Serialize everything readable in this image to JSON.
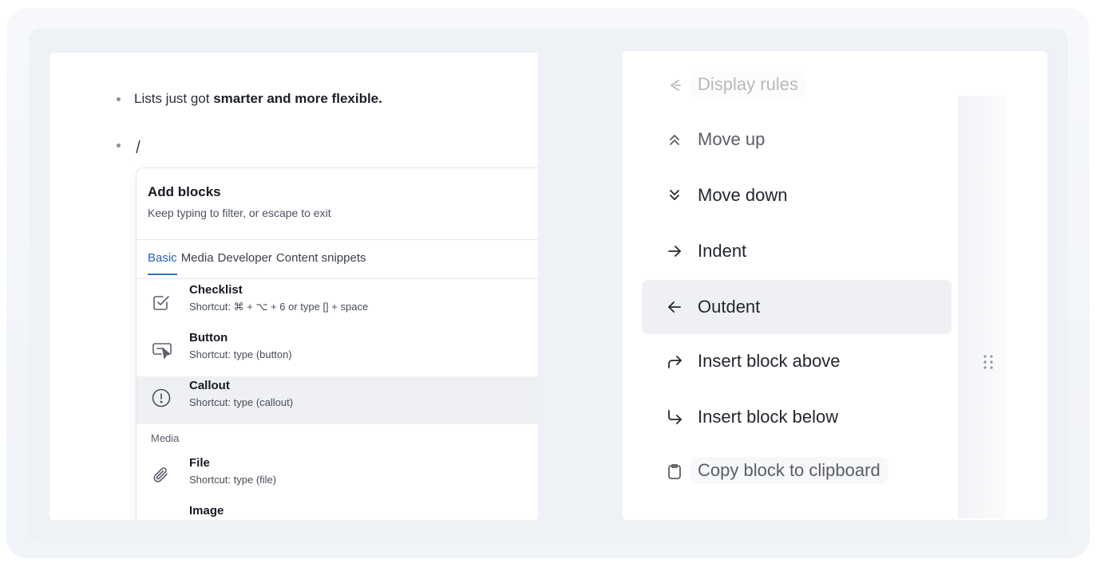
{
  "document": {
    "bullet_plain": "Lists just got ",
    "bullet_bold": "smarter and more flexible.",
    "caret_text": "/"
  },
  "add_blocks": {
    "title": "Add blocks",
    "subtitle": "Keep typing to filter, or escape to exit",
    "tabs": [
      "Basic",
      "Media",
      "Developer",
      "Content snippets"
    ],
    "active_tab": "Basic",
    "items": [
      {
        "title": "Checklist",
        "shortcut": "Shortcut: ⌘ + ⌥ + 6 or type [] + space",
        "icon": "checklist-icon"
      },
      {
        "title": "Button",
        "shortcut": "Shortcut: type (button)",
        "icon": "button-cursor-icon"
      },
      {
        "title": "Callout",
        "shortcut": "Shortcut: type (callout)",
        "icon": "exclamation-circle-icon"
      }
    ],
    "media_section_label": "Media",
    "media_items": [
      {
        "title": "File",
        "shortcut": "Shortcut: type (file)",
        "icon": "paperclip-icon"
      },
      {
        "title": "Image",
        "shortcut": "",
        "icon": "image-icon"
      }
    ]
  },
  "block_menu": {
    "items": [
      {
        "label": "Display rules",
        "icon": "display-rules-icon"
      },
      {
        "label": "Move up",
        "icon": "chevrons-up-icon"
      },
      {
        "label": "Move down",
        "icon": "chevrons-down-icon"
      },
      {
        "label": "Indent",
        "icon": "arrow-right-icon"
      },
      {
        "label": "Outdent",
        "icon": "arrow-left-icon"
      },
      {
        "label": "Insert block above",
        "icon": "corner-up-right-icon"
      },
      {
        "label": "Insert block below",
        "icon": "corner-down-right-icon"
      },
      {
        "label": "Copy block to clipboard",
        "icon": "clipboard-icon"
      }
    ],
    "active_item": "Outdent"
  },
  "colors": {
    "accent": "#2a62b8",
    "highlight": "#eef0f3"
  }
}
